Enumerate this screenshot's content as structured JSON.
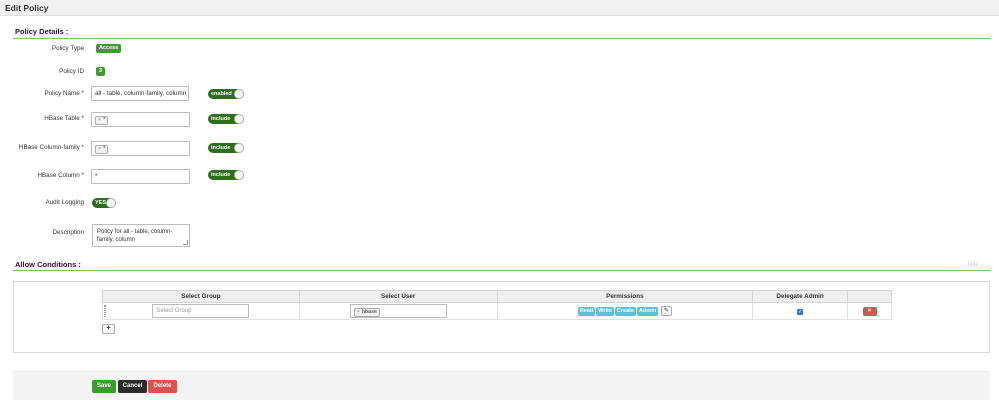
{
  "header": {
    "title": "Edit Policy"
  },
  "policy_details": {
    "title": "Policy Details :",
    "policy_type": {
      "label": "Policy Type",
      "value": "Access"
    },
    "policy_id": {
      "label": "Policy ID",
      "value": "3"
    },
    "policy_name": {
      "label": "Policy Name",
      "required": "*",
      "value": "all - table, column-family, column",
      "toggle": "enabled"
    },
    "hbase_table": {
      "label": "HBase Table",
      "required": "*",
      "tag": "*",
      "toggle": "include"
    },
    "hbase_column_family": {
      "label": "HBase Column-family",
      "required": "*",
      "tag": "*",
      "toggle": "include"
    },
    "hbase_column": {
      "label": "HBase Column",
      "required": "*",
      "value": "*",
      "toggle": "include"
    },
    "audit_logging": {
      "label": "Audit Logging",
      "toggle": "YES"
    },
    "description": {
      "label": "Description",
      "value": "Policy for all - table, column-family, column"
    }
  },
  "allow_conditions": {
    "title": "Allow Conditions :",
    "hide_link": "hide ⌄",
    "columns": [
      "Select Group",
      "Select User",
      "Permissions",
      "Delegate Admin"
    ],
    "row": {
      "group_placeholder": "Select Group",
      "user_tag": "hbase",
      "permissions": [
        "Read",
        "Write",
        "Create",
        "Admin"
      ],
      "delegate_admin": true
    },
    "add_label": "+"
  },
  "footer": {
    "save": "Save",
    "cancel": "Cancel",
    "delete": "Delete"
  },
  "colors": {
    "accent_green": "#3d9b2f",
    "toggle_green": "#2e6f1d",
    "perm_blue": "#5bc0de",
    "danger": "#d9534f"
  }
}
